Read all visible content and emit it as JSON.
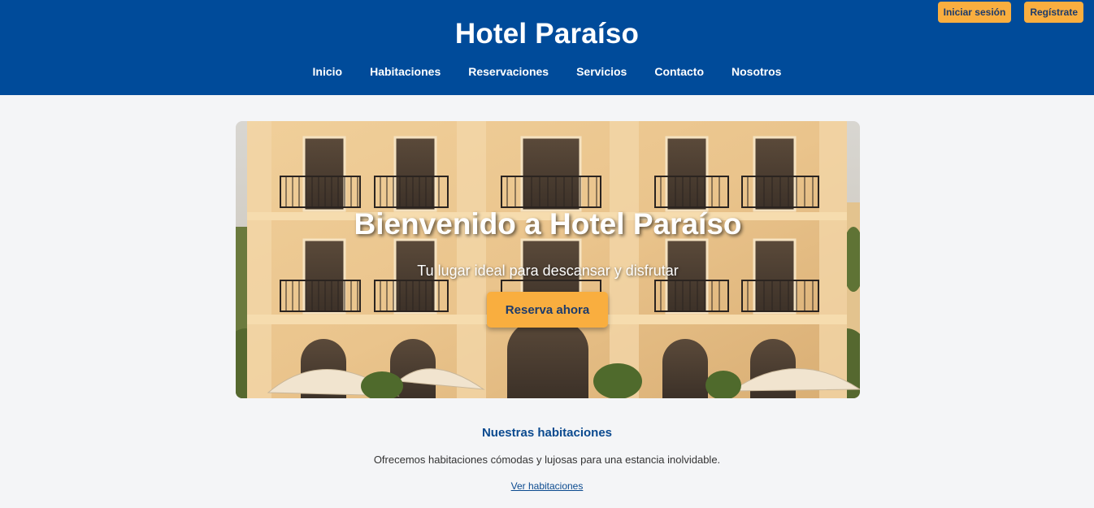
{
  "header": {
    "title": "Hotel Paraíso",
    "nav": [
      "Inicio",
      "Habitaciones",
      "Reservaciones",
      "Servicios",
      "Contacto",
      "Nosotros"
    ],
    "login_label": "Iniciar sesión",
    "register_label": "Regístrate"
  },
  "hero": {
    "title": "Bienvenido a Hotel Paraíso",
    "subtitle": "Tu lugar ideal para descansar y disfrutar",
    "cta_label": "Reserva ahora",
    "image_icon": "hotel-facade-image"
  },
  "rooms": {
    "heading": "Nuestras habitaciones",
    "description": "Ofrecemos habitaciones cómodas y lujosas para una estancia inolvidable.",
    "link_label": "Ver habitaciones"
  },
  "colors": {
    "header_bg": "#004b9a",
    "accent": "#f9ae3f",
    "link": "#0b4a8f",
    "page_bg": "#f4f5f7"
  }
}
